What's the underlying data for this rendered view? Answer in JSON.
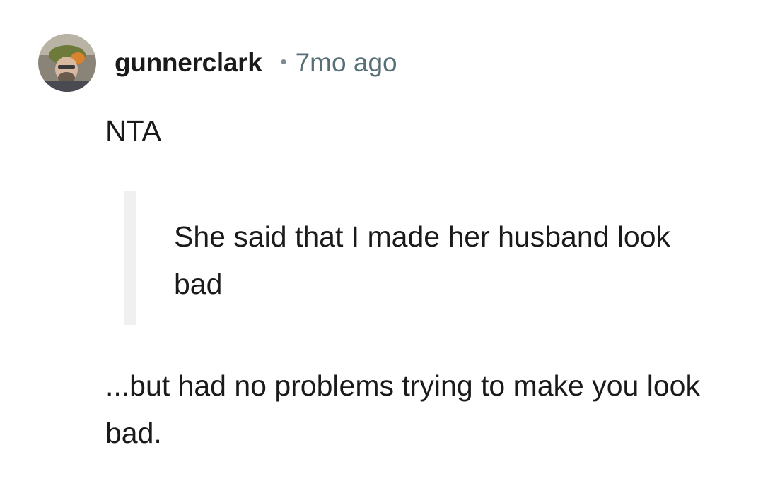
{
  "comment": {
    "author": {
      "username": "gunnerclark",
      "avatar_icon": "user-avatar-photo"
    },
    "separator": "•",
    "timestamp": "7mo ago",
    "verdict": "NTA",
    "quote": "She said that I made her husband look bad",
    "body": "...but had no problems trying to make you look bad."
  },
  "colors": {
    "text": "#1a1a1b",
    "meta": "#576f76",
    "quote_bar": "#f0f0f0",
    "background": "#ffffff"
  }
}
